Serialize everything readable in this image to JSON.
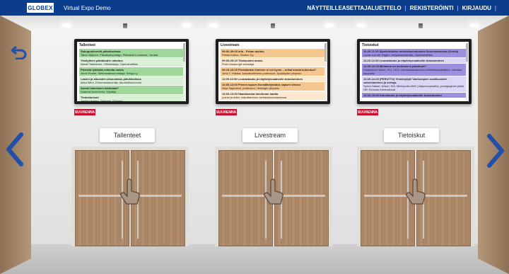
{
  "header": {
    "logo": "GLOBEX",
    "title": "Virtual Expo Demo",
    "nav": [
      "NÄYTTEILLEASETTAJALUETTELO",
      "REKISTERÖINTI",
      "KIRJAUDU"
    ]
  },
  "colors": {
    "topbar": "#0a3d8c",
    "zoom_button": "#c8102e"
  },
  "icons": {
    "back": "undo-arrow-icon",
    "prev": "chevron-left-icon",
    "next": "chevron-right-icon",
    "door": "hand-pointer-icon"
  },
  "screens": [
    {
      "title": "Tallenteet",
      "zoom_label": "SUURENNA",
      "entries": [
        {
          "style": "green1",
          "title": "Sukupuolineutti päiväkodissa",
          "text": "Taina Viljanen, Päiväkotiopettaja, Päiväkoti Lootomas, Vantaa"
        },
        {
          "style": "green2",
          "title": "Yksilyiteen päiväkodin rahoitus",
          "text": "Aksali Tarkkanen, Ylilehteskija, Opetushallitus"
        },
        {
          "style": "green1",
          "title": "Pienistä lyödistä rohkeita naisia",
          "text": "Jenni Huolet, Siekusaakoulunettaja, Sreppi ry"
        },
        {
          "style": "green2",
          "title": "Lasten ja aikuisten ulkoustatus päiväkodissa",
          "text": "Alisa Mero, Enkunsaaavuntija, Akuheltiiroivonsia"
        },
        {
          "style": "green1",
          "title": "Suomi lukemisen kärkimaa?",
          "text": "Kaarina Numminen, Kirjailija"
        },
        {
          "style": "green2",
          "title": "Tietoiskulsuti",
          "text": "Jaakko Isotalo, Teetaaja, Globeex"
        }
      ]
    },
    {
      "title": "Livestream",
      "zoom_label": "SUURENNA",
      "entries": [
        {
          "style": "orange1",
          "title": "09:00-09:05 Info - Pekan aloitus",
          "text": "Pekka Kukko, Globex Oy"
        },
        {
          "style": "orange2",
          "title": "09:05-09:15 Tilaisuuden avaus",
          "text": "Porin kaupungin edustaja"
        },
        {
          "style": "orange1",
          "title": "09:15-10:15 Pientalotwk ihminen ei voi hyvin – mikai koiuta kukeutua?",
          "text": "Juha T. Hakala, kasvatustieteen professori, Jyväskylän yliopisto"
        },
        {
          "style": "orange2",
          "title": "11:00-12:30 Lounastauko ja näyttelyssaalsolin tutustuminen",
          "text": ""
        },
        {
          "style": "orange1",
          "title": "12:30-13:00 Pienen lapsen lisesäätelytaidot, lapsen stressi",
          "text": "Nina Sajaniemi, professori, Helsingin yliopisto"
        },
        {
          "style": "orange2",
          "title": "13:20-14:20 Haastavasta toiminnan kautta",
          "text": "puinel ja niihin vaikuttaminen varhaiskasvatuksessa"
        }
      ]
    },
    {
      "title": "Tietoiskut",
      "zoom_label": "SUURENNA",
      "entries": [
        {
          "style": "purple1",
          "title": "10:40-11:20 Ajankohtaista varhaiskasvatuksen lietovarannosta (Versio)",
          "text": "Laura von der Hagen, erityisasiantuntija, Opetushallitus"
        },
        {
          "style": "purple2",
          "title": "11:20-12:30 Lounastauko ja näyttelyssaalsolin tutustuminen",
          "text": ""
        },
        {
          "style": "purple1",
          "title": "12:30-13:15 Millainen on kiehitsteen päiväkoti?",
          "text": "Kaijamaria Haime, KM, VEO, varhaiskasvatuksen kehittämispäällikkö, Vantaan kaupunki"
        },
        {
          "style": "purple2",
          "title": "13:20-14:20 (PERUTTU) Yhteistyöjä! Vanhempien osallisuuden vahvistaminen ja kertoja",
          "text": "Sylvia Hakari, lehtori, KM, Metropolia AMK (ohjaussopmalla), podagoginen pitää, HEI Schools International"
        },
        {
          "style": "purple1",
          "title": "14:30-15:00 Kahvitauko ja näyttelyssaalsolin tutustuminen",
          "text": ""
        }
      ]
    }
  ],
  "doors": [
    {
      "label": "Tallenteet"
    },
    {
      "label": "Livestream"
    },
    {
      "label": "Tietoiskut"
    }
  ]
}
